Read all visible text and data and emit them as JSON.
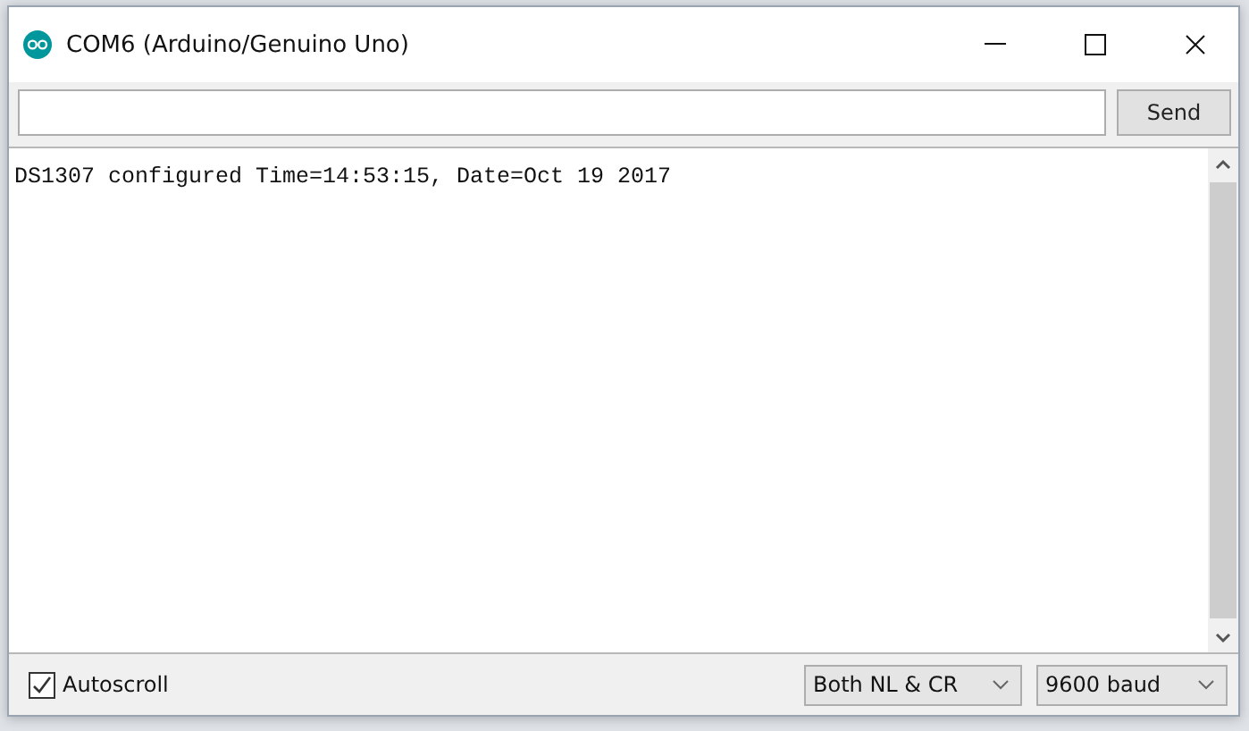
{
  "window": {
    "title": "COM6 (Arduino/Genuino Uno)"
  },
  "send_button": "Send",
  "output": {
    "lines": [
      "DS1307 configured Time=14:53:15, Date=Oct 19 2017"
    ]
  },
  "autoscroll": {
    "label": "Autoscroll",
    "checked": true
  },
  "line_ending": "Both NL & CR",
  "baud_rate": "9600 baud"
}
